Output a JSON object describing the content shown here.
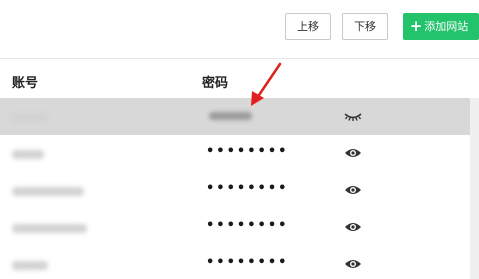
{
  "toolbar": {
    "move_up_label": "上移",
    "move_down_label": "下移",
    "add_site_label": "添加网站",
    "add_icon": "+"
  },
  "table": {
    "headers": {
      "account": "账号",
      "password": "密码"
    },
    "rows": [
      {
        "masked_password": "",
        "state": "selected",
        "eye": "eye-closed-icon"
      },
      {
        "masked_password": "••••••••",
        "state": "normal",
        "eye": "eye-icon"
      },
      {
        "masked_password": "••••••••",
        "state": "normal",
        "eye": "eye-icon"
      },
      {
        "masked_password": "••••••••",
        "state": "normal",
        "eye": "eye-icon"
      },
      {
        "masked_password": "••••••••",
        "state": "normal",
        "eye": "eye-icon"
      }
    ]
  },
  "colors": {
    "accent_green": "#22c36b",
    "selected_row": "#d8d8d8",
    "annotation_arrow": "#e02020"
  }
}
